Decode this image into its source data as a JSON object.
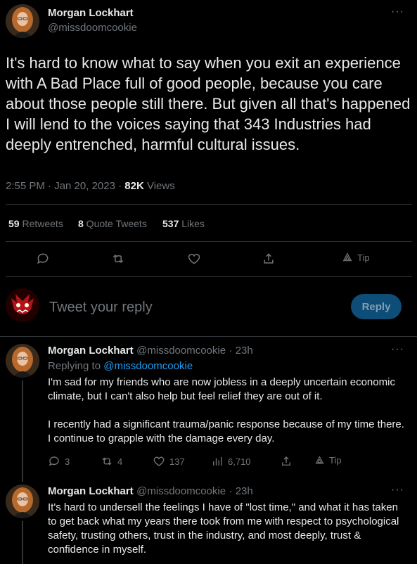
{
  "main_tweet": {
    "author_name": "Morgan Lockhart",
    "author_handle": "@missdoomcookie",
    "more_label": "···",
    "text": "It's hard to know what to say when you exit an experience with A Bad Place full of good people, because you care about those people still there. But given all that's happened I will lend to the voices saying that 343 Industries had deeply entrenched, harmful cultural issues.",
    "time": "2:55 PM · Jan 20, 2023 · ",
    "views_count": "82K",
    "views_label": " Views",
    "retweets_count": "59",
    "retweets_label": " Retweets",
    "quotes_count": "8",
    "quotes_label": " Quote Tweets",
    "likes_count": "537",
    "likes_label": " Likes",
    "tip_label": "Tip"
  },
  "composer": {
    "placeholder": "Tweet your reply",
    "reply_button": "Reply"
  },
  "replies": [
    {
      "author_name": "Morgan Lockhart",
      "author_handle": "@missdoomcookie",
      "age": "· 23h",
      "replying_to_prefix": "Replying to ",
      "replying_to_handle": "@missdoomcookie",
      "para1": "I'm sad for my friends who are now jobless in a deeply uncertain economic climate, but I can't also help but feel relief they are out of it.",
      "para2": "I recently had a significant trauma/panic response because of my time there. I continue to grapple with the damage every day.",
      "reply_count": "3",
      "retweet_count": "4",
      "like_count": "137",
      "view_count": "6,710",
      "tip_label": "Tip"
    },
    {
      "author_name": "Morgan Lockhart",
      "author_handle": "@missdoomcookie",
      "age": "· 23h",
      "para1": "It's hard to undersell the feelings I have of \"lost time,\" and what it has taken to get back what my years there took from me with respect to psychological safety, trusting others, trust in the industry, and most deeply, trust & confidence in myself."
    }
  ],
  "more_label": "···"
}
